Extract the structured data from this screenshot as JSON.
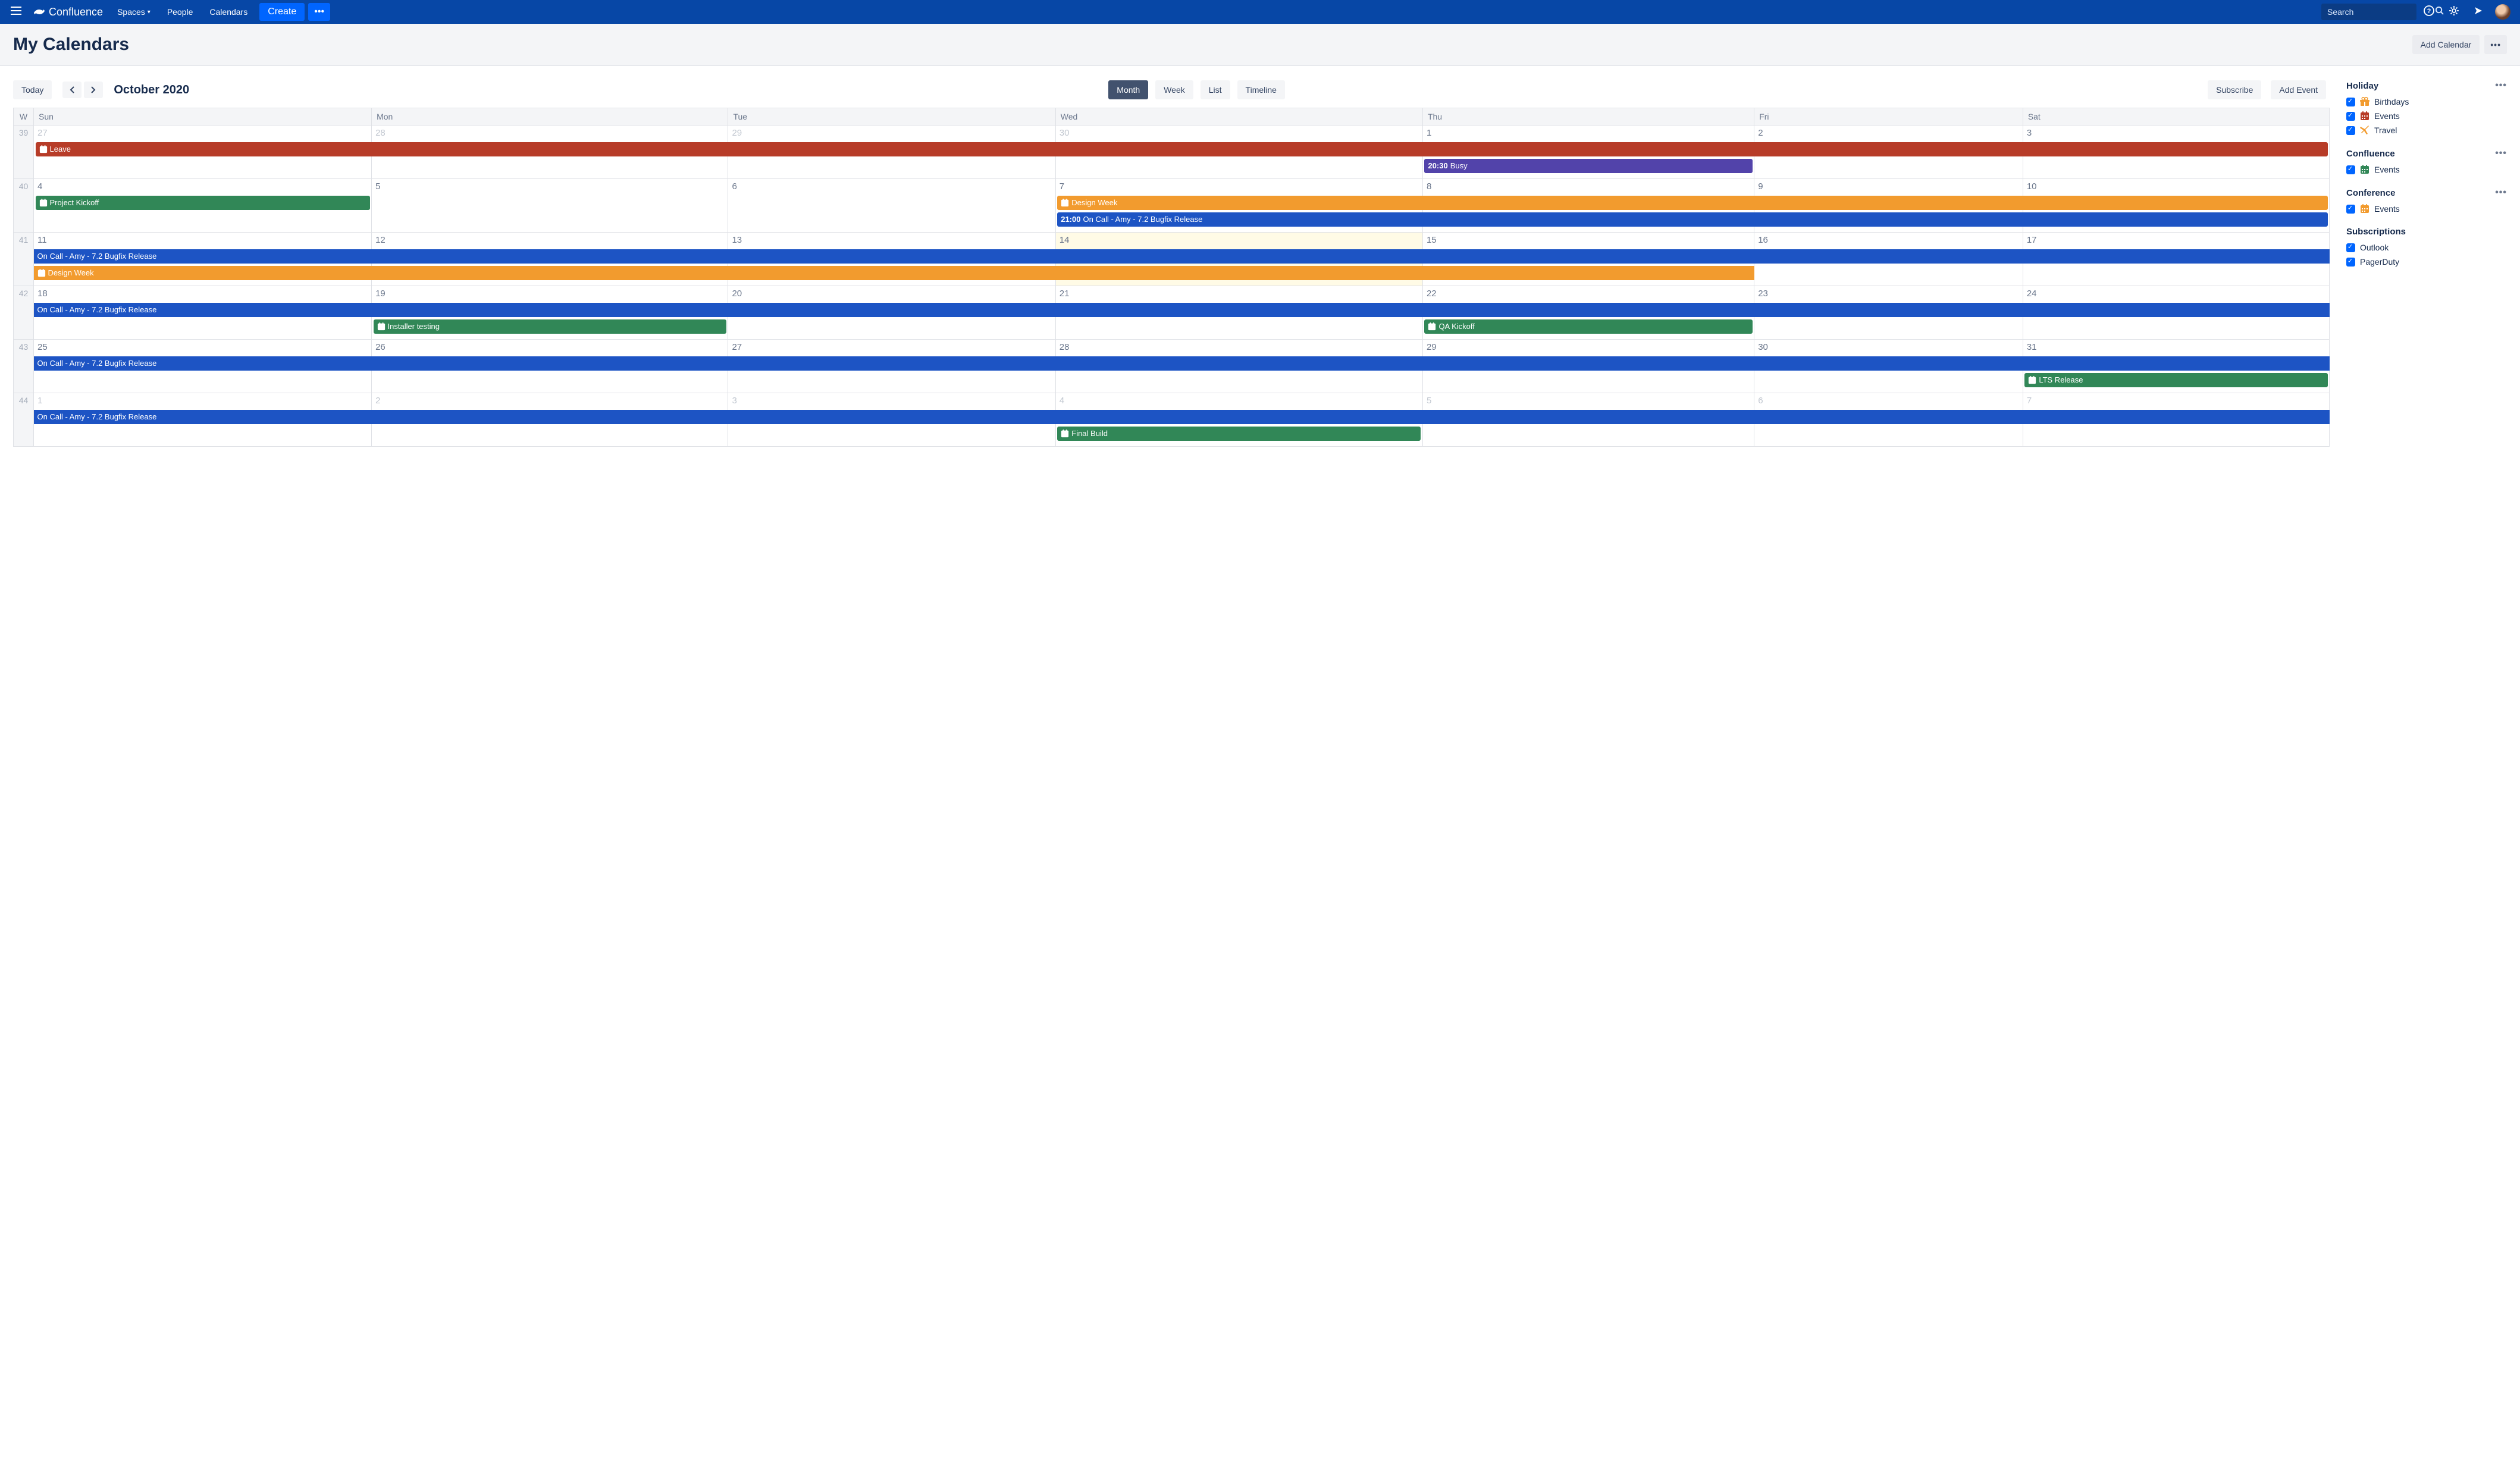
{
  "app": {
    "name": "Confluence"
  },
  "nav": {
    "spaces": "Spaces",
    "people": "People",
    "calendars": "Calendars",
    "create": "Create",
    "search_placeholder": "Search"
  },
  "page": {
    "title": "My Calendars",
    "add_calendar": "Add Calendar"
  },
  "toolbar": {
    "today": "Today",
    "label": "October 2020",
    "views": {
      "month": "Month",
      "week": "Week",
      "list": "List",
      "timeline": "Timeline"
    },
    "active_view": "month",
    "subscribe": "Subscribe",
    "add_event": "Add Event"
  },
  "day_headers": {
    "w": "W",
    "sun": "Sun",
    "mon": "Mon",
    "tue": "Tue",
    "wed": "Wed",
    "thu": "Thu",
    "fri": "Fri",
    "sat": "Sat"
  },
  "weeks": [
    {
      "wk": "39",
      "days": [
        "27",
        "28",
        "29",
        "30",
        "1",
        "2",
        "3"
      ],
      "other": [
        0,
        1,
        2,
        3
      ]
    },
    {
      "wk": "40",
      "days": [
        "4",
        "5",
        "6",
        "7",
        "8",
        "9",
        "10"
      ]
    },
    {
      "wk": "41",
      "days": [
        "11",
        "12",
        "13",
        "14",
        "15",
        "16",
        "17"
      ],
      "today_idx": 3
    },
    {
      "wk": "42",
      "days": [
        "18",
        "19",
        "20",
        "21",
        "22",
        "23",
        "24"
      ]
    },
    {
      "wk": "43",
      "days": [
        "25",
        "26",
        "27",
        "28",
        "29",
        "30",
        "31"
      ]
    },
    {
      "wk": "44",
      "days": [
        "1",
        "2",
        "3",
        "4",
        "5",
        "6",
        "7"
      ],
      "other": [
        0,
        1,
        2,
        3,
        4,
        5,
        6
      ]
    }
  ],
  "events": [
    {
      "row": 0,
      "slot": 0,
      "start": 0,
      "span": 7,
      "color": "dark-red",
      "icon": true,
      "label": "Leave"
    },
    {
      "row": 0,
      "slot": 1,
      "start": 4,
      "span": 1,
      "color": "purple",
      "time": "20:30",
      "label": "Busy"
    },
    {
      "row": 1,
      "slot": 0,
      "start": 0,
      "span": 1,
      "color": "green",
      "icon": true,
      "label": "Project Kickoff"
    },
    {
      "row": 1,
      "slot": 0,
      "start": 3,
      "span": 4,
      "color": "orange",
      "icon": true,
      "label": "Design Week"
    },
    {
      "row": 1,
      "slot": 1,
      "start": 3,
      "span": 4,
      "color": "blue",
      "time": "21:00",
      "label": "On Call - Amy - 7.2 Bugfix Release"
    },
    {
      "row": 2,
      "slot": 0,
      "start": 0,
      "span": 7,
      "color": "blue",
      "label": "On Call - Amy - 7.2 Bugfix Release",
      "flush": true
    },
    {
      "row": 2,
      "slot": 1,
      "start": 0,
      "span": 5,
      "color": "orange",
      "icon": true,
      "label": "Design Week",
      "flush": true
    },
    {
      "row": 3,
      "slot": 0,
      "start": 0,
      "span": 7,
      "color": "blue",
      "label": "On Call - Amy - 7.2 Bugfix Release",
      "flush": true
    },
    {
      "row": 3,
      "slot": 1,
      "start": 1,
      "span": 1,
      "color": "green",
      "icon": true,
      "label": "Installer testing"
    },
    {
      "row": 3,
      "slot": 1,
      "start": 4,
      "span": 1,
      "color": "green",
      "icon": true,
      "label": "QA Kickoff"
    },
    {
      "row": 4,
      "slot": 0,
      "start": 0,
      "span": 7,
      "color": "blue",
      "label": "On Call - Amy - 7.2 Bugfix Release",
      "flush": true
    },
    {
      "row": 4,
      "slot": 1,
      "start": 6,
      "span": 1,
      "color": "green",
      "icon": true,
      "label": "LTS Release"
    },
    {
      "row": 5,
      "slot": 0,
      "start": 0,
      "span": 7,
      "color": "blue",
      "label": "On Call - Amy - 7.2 Bugfix Release",
      "flush": true
    },
    {
      "row": 5,
      "slot": 1,
      "start": 3,
      "span": 1,
      "color": "green",
      "icon": true,
      "label": "Final Build"
    }
  ],
  "sidebar": {
    "sections": [
      {
        "title": "Holiday",
        "dots": true,
        "items": [
          {
            "label": "Birthdays",
            "icon": "gift",
            "color": "#F29B2E",
            "checked": true
          },
          {
            "label": "Events",
            "icon": "calendar",
            "color": "#B73C28",
            "checked": true
          },
          {
            "label": "Travel",
            "icon": "plane",
            "color": "#F29B2E",
            "checked": true
          }
        ]
      },
      {
        "title": "Confluence",
        "dots": true,
        "items": [
          {
            "label": "Events",
            "icon": "calendar",
            "color": "#318757",
            "checked": true
          }
        ]
      },
      {
        "title": "Conference",
        "dots": true,
        "items": [
          {
            "label": "Events",
            "icon": "calendar",
            "color": "#F29B2E",
            "checked": true
          }
        ]
      },
      {
        "title": "Subscriptions",
        "dots": false,
        "items": [
          {
            "label": "Outlook",
            "checked": true
          },
          {
            "label": "PagerDuty",
            "checked": true
          }
        ]
      }
    ]
  }
}
